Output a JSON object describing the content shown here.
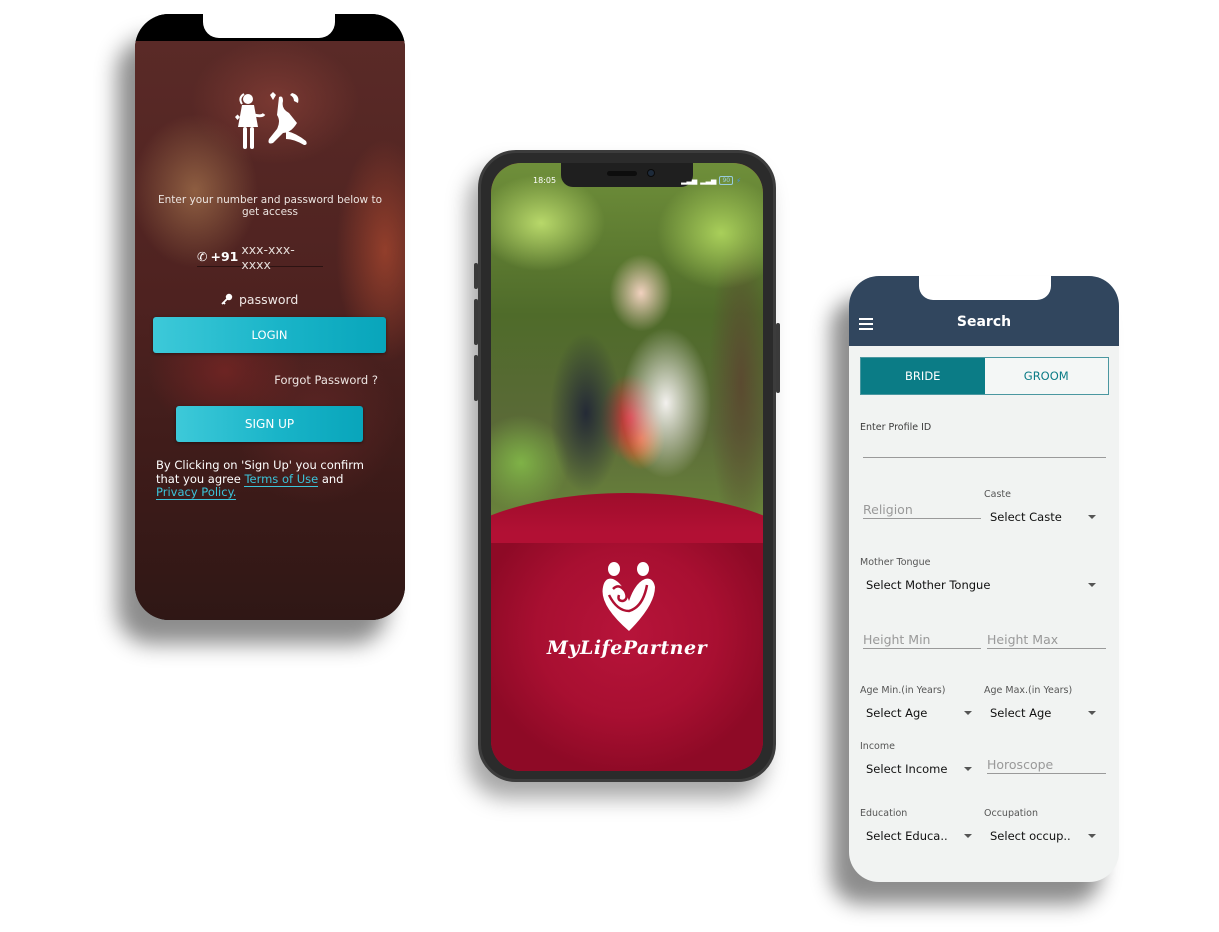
{
  "login_screen": {
    "subtitle": "Enter your number and password below to get access",
    "phone_prefix": "+91",
    "phone_placeholder": "xxx-xxx-xxxx",
    "password_placeholder": "password",
    "login_label": "LOGIN",
    "forgot_label": "Forgot Password ?",
    "signup_label": "SIGN UP",
    "terms_text_1": "By Clicking on 'Sign Up' you confirm that you agree ",
    "terms_link": "Terms of Use",
    "terms_and": " and ",
    "privacy_link": "Privacy Policy.",
    "icons": {
      "logo": "couple-proposal-icon",
      "phone": "phone-icon",
      "password": "key-icon"
    },
    "colors": {
      "button": "#19b4c8",
      "link": "#3cc4da"
    }
  },
  "splash_screen": {
    "status_time": "18:05",
    "battery": "90",
    "brand_name": "MyLifePartner",
    "icons": {
      "logo": "heart-couple-logo-icon",
      "signal": "signal-icon",
      "battery": "battery-icon"
    },
    "colors": {
      "brand": "#b01032"
    }
  },
  "search_screen": {
    "title": "Search",
    "tabs": [
      {
        "label": "BRIDE",
        "active": true
      },
      {
        "label": "GROOM",
        "active": false
      }
    ],
    "profile_id_label": "Enter Profile ID",
    "religion_placeholder": "Religion",
    "caste_label": "Caste",
    "caste_value": "Select Caste",
    "mother_tongue_label": "Mother Tongue",
    "mother_tongue_value": "Select Mother Tongue",
    "height_min_placeholder": "Height Min",
    "height_max_placeholder": "Height Max",
    "age_min_label": "Age Min.(in Years)",
    "age_min_value": "Select Age",
    "age_max_label": "Age Max.(in Years)",
    "age_max_value": "Select Age",
    "income_label": "Income",
    "income_value": "Select Income",
    "horoscope_placeholder": "Horoscope",
    "education_label": "Education",
    "education_value": "Select Educa..",
    "occupation_label": "Occupation",
    "occupation_value": "Select occup..",
    "colors": {
      "header": "#31465e",
      "accent": "#0b7c86"
    }
  }
}
